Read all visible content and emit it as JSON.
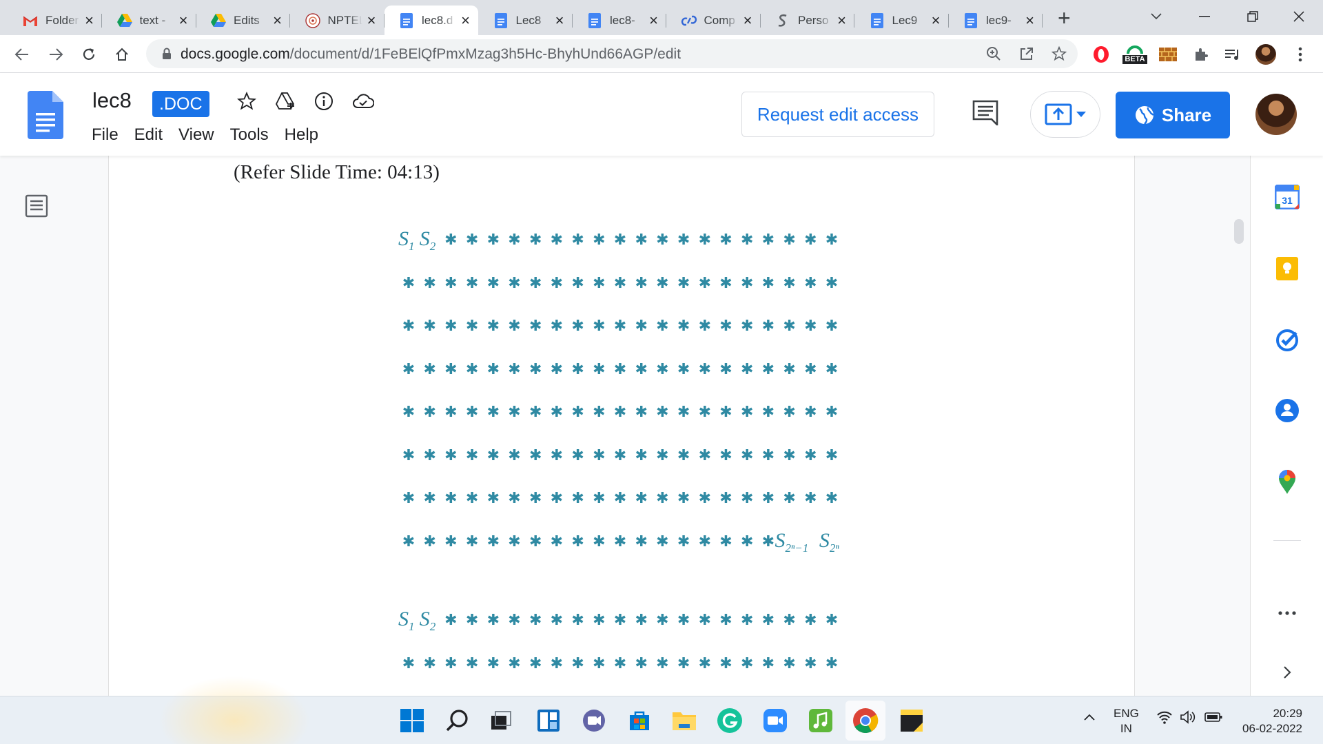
{
  "browser": {
    "tabs": [
      {
        "label": "Folder",
        "icon": "gmail-icon",
        "active": false
      },
      {
        "label": "text - ",
        "icon": "google-drive-icon",
        "active": false
      },
      {
        "label": "Edits",
        "icon": "google-drive-icon",
        "active": false
      },
      {
        "label": "NPTEL",
        "icon": "nptel-icon",
        "active": false
      },
      {
        "label": "lec8.d",
        "icon": "google-docs-icon",
        "active": true
      },
      {
        "label": "Lec8",
        "icon": "google-docs-icon",
        "active": false
      },
      {
        "label": "lec8-",
        "icon": "google-docs-icon",
        "active": false
      },
      {
        "label": "Comp",
        "icon": "link-icon",
        "active": false
      },
      {
        "label": "Perso",
        "icon": "paste-icon",
        "active": false
      },
      {
        "label": "Lec9",
        "icon": "google-docs-icon",
        "active": false
      },
      {
        "label": "lec9-",
        "icon": "google-docs-icon",
        "active": false
      }
    ],
    "url_host": "docs.google.com",
    "url_path": "/document/d/1FeBElQfPmxMzag3h5Hc-BhyhUnd66AGP/edit",
    "extension_badge": "BETA"
  },
  "doc": {
    "title": "lec8",
    "badge": ".DOC",
    "menu": [
      "File",
      "Edit",
      "View",
      "Tools",
      "Help"
    ],
    "request_edit_label": "Request edit access",
    "share_label": "Share",
    "slide_time_text": "(Refer Slide Time: 04:13)",
    "grid_color": "#2f8aa3",
    "star_glyph": "✱",
    "label_s1": "S",
    "label_s1_sub": "1",
    "label_s2": "S",
    "label_s2_sub": "2",
    "label_s2n_minus_1": "S",
    "label_s2n_minus_1_sub": "2ⁿ−1",
    "label_s2n": "S",
    "label_s2n_sub": "2ⁿ"
  },
  "side_panel": [
    "calendar-icon",
    "keep-icon",
    "tasks-icon",
    "contacts-icon",
    "maps-icon"
  ],
  "side_panel_calendar_day": "31",
  "taskbar": {
    "lang_line1": "ENG",
    "lang_line2": "IN",
    "time": "20:29",
    "date": "06-02-2022"
  },
  "colors": {
    "accent": "#1a73e8",
    "docs_blue": "#4285f4"
  }
}
